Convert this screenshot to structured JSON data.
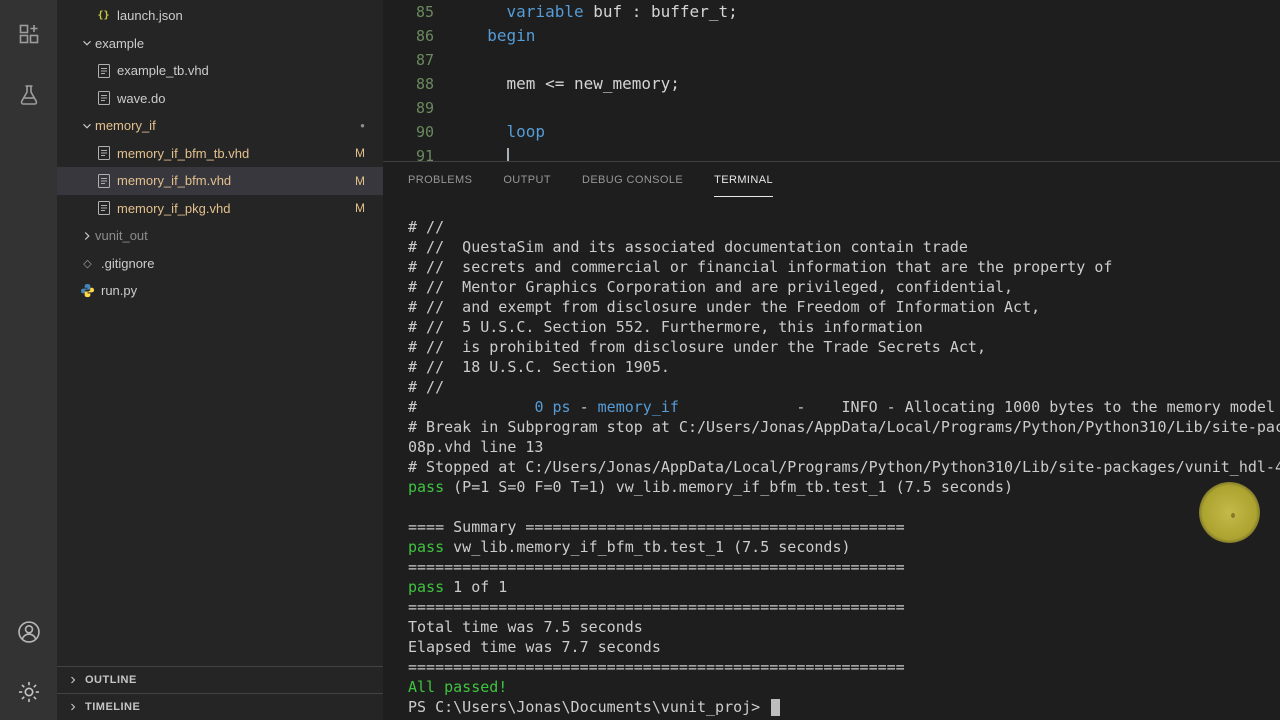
{
  "colors": {
    "gold": "#e2c08d",
    "pass_green": "#3fc43f",
    "keyword_blue": "#569cd6",
    "terminal_text": "#cccccc"
  },
  "icon_glyphs": {
    "json": "{}",
    "gitignore": "◇",
    "dot": "●"
  },
  "activity_bar": {
    "top_icons": [
      {
        "name": "extensions-icon"
      },
      {
        "name": "test-beaker-icon"
      }
    ],
    "bottom_icons": [
      {
        "name": "account-icon"
      },
      {
        "name": "settings-gear-icon"
      }
    ]
  },
  "sidebar": {
    "files": [
      {
        "label": "launch.json",
        "indent": 2,
        "icon": "json",
        "color": "normal"
      },
      {
        "label": "example",
        "indent": 1,
        "icon": "folder",
        "expanded": true,
        "color": "normal"
      },
      {
        "label": "example_tb.vhd",
        "indent": 2,
        "icon": "file",
        "color": "normal"
      },
      {
        "label": "wave.do",
        "indent": 2,
        "icon": "file",
        "color": "normal"
      },
      {
        "label": "memory_if",
        "indent": 1,
        "icon": "folder",
        "expanded": true,
        "color": "gold",
        "dot": true
      },
      {
        "label": "memory_if_bfm_tb.vhd",
        "indent": 2,
        "icon": "file",
        "color": "gold",
        "badge": "M"
      },
      {
        "label": "memory_if_bfm.vhd",
        "indent": 2,
        "icon": "file",
        "color": "gold",
        "badge": "M",
        "selected": true
      },
      {
        "label": "memory_if_pkg.vhd",
        "indent": 2,
        "icon": "file",
        "color": "gold",
        "badge": "M"
      },
      {
        "label": "vunit_out",
        "indent": 1,
        "icon": "folder",
        "expanded": false,
        "color": "dim"
      },
      {
        "label": ".gitignore",
        "indent": 1,
        "icon": "gitignore",
        "color": "normal"
      },
      {
        "label": "run.py",
        "indent": 1,
        "icon": "python",
        "color": "normal"
      }
    ],
    "sections": [
      {
        "label": "OUTLINE"
      },
      {
        "label": "TIMELINE"
      }
    ]
  },
  "editor": {
    "lines": [
      {
        "num": "85",
        "segs": [
          {
            "t": "    "
          },
          {
            "t": "variable",
            "c": "kw"
          },
          {
            "t": " buf : buffer_t;"
          }
        ]
      },
      {
        "num": "86",
        "segs": [
          {
            "t": "  "
          },
          {
            "t": "begin",
            "c": "kw"
          }
        ]
      },
      {
        "num": "87",
        "segs": []
      },
      {
        "num": "88",
        "segs": [
          {
            "t": "    mem <= new_memory;"
          }
        ]
      },
      {
        "num": "89",
        "segs": []
      },
      {
        "num": "90",
        "segs": [
          {
            "t": "    "
          },
          {
            "t": "loop",
            "c": "kw"
          }
        ]
      },
      {
        "num": "91",
        "segs": []
      }
    ]
  },
  "panel": {
    "tabs": [
      {
        "label": "PROBLEMS"
      },
      {
        "label": "OUTPUT"
      },
      {
        "label": "DEBUG CONSOLE"
      },
      {
        "label": "TERMINAL",
        "active": true
      }
    ],
    "terminal_lines": [
      [
        {
          "t": "# //"
        }
      ],
      [
        {
          "t": "# //  QuestaSim and its associated documentation contain trade"
        }
      ],
      [
        {
          "t": "# //  secrets and commercial or financial information that are the property of"
        }
      ],
      [
        {
          "t": "# //  Mentor Graphics Corporation and are privileged, confidential,"
        }
      ],
      [
        {
          "t": "# //  and exempt from disclosure under the Freedom of Information Act,"
        }
      ],
      [
        {
          "t": "# //  5 U.S.C. Section 552. Furthermore, this information"
        }
      ],
      [
        {
          "t": "# //  is prohibited from disclosure under the Trade Secrets Act,"
        }
      ],
      [
        {
          "t": "# //  18 U.S.C. Section 1905."
        }
      ],
      [
        {
          "t": "# //"
        }
      ],
      [
        {
          "t": "#             "
        },
        {
          "t": "0 ps",
          "c": "blue"
        },
        {
          "t": " - "
        },
        {
          "t": "memory_if",
          "c": "blue"
        },
        {
          "t": "             -    "
        },
        {
          "t": "INFO - Allocating 1000 bytes to the memory model"
        }
      ],
      [
        {
          "t": "# Break in Subprogram stop at C:/Users/Jonas/AppData/Local/Programs/Python/Python310/Lib/site-pac"
        }
      ],
      [
        {
          "t": "08p.vhd line 13"
        }
      ],
      [
        {
          "t": "# Stopped at C:/Users/Jonas/AppData/Local/Programs/Python/Python310/Lib/site-packages/vunit_hdl-4"
        }
      ],
      [
        {
          "t": "pass",
          "c": "green"
        },
        {
          "t": " (P=1 S=0 F=0 T=1) vw_lib.memory_if_bfm_tb.test_1 (7.5 seconds)"
        }
      ],
      [],
      [
        {
          "t": "==== Summary =========================================="
        }
      ],
      [
        {
          "t": "pass",
          "c": "green"
        },
        {
          "t": " vw_lib.memory_if_bfm_tb.test_1 (7.5 seconds)"
        }
      ],
      [
        {
          "t": "======================================================="
        }
      ],
      [
        {
          "t": "pass",
          "c": "green"
        },
        {
          "t": " 1 of 1"
        }
      ],
      [
        {
          "t": "======================================================="
        }
      ],
      [
        {
          "t": "Total time was 7.5 seconds"
        }
      ],
      [
        {
          "t": "Elapsed time was 7.7 seconds"
        }
      ],
      [
        {
          "t": "======================================================="
        }
      ],
      [
        {
          "t": "All passed!",
          "c": "green"
        }
      ],
      [
        {
          "t": "PS C:\\Users\\Jonas\\Documents\\vunit_proj> "
        },
        {
          "cursor": true
        }
      ]
    ]
  }
}
